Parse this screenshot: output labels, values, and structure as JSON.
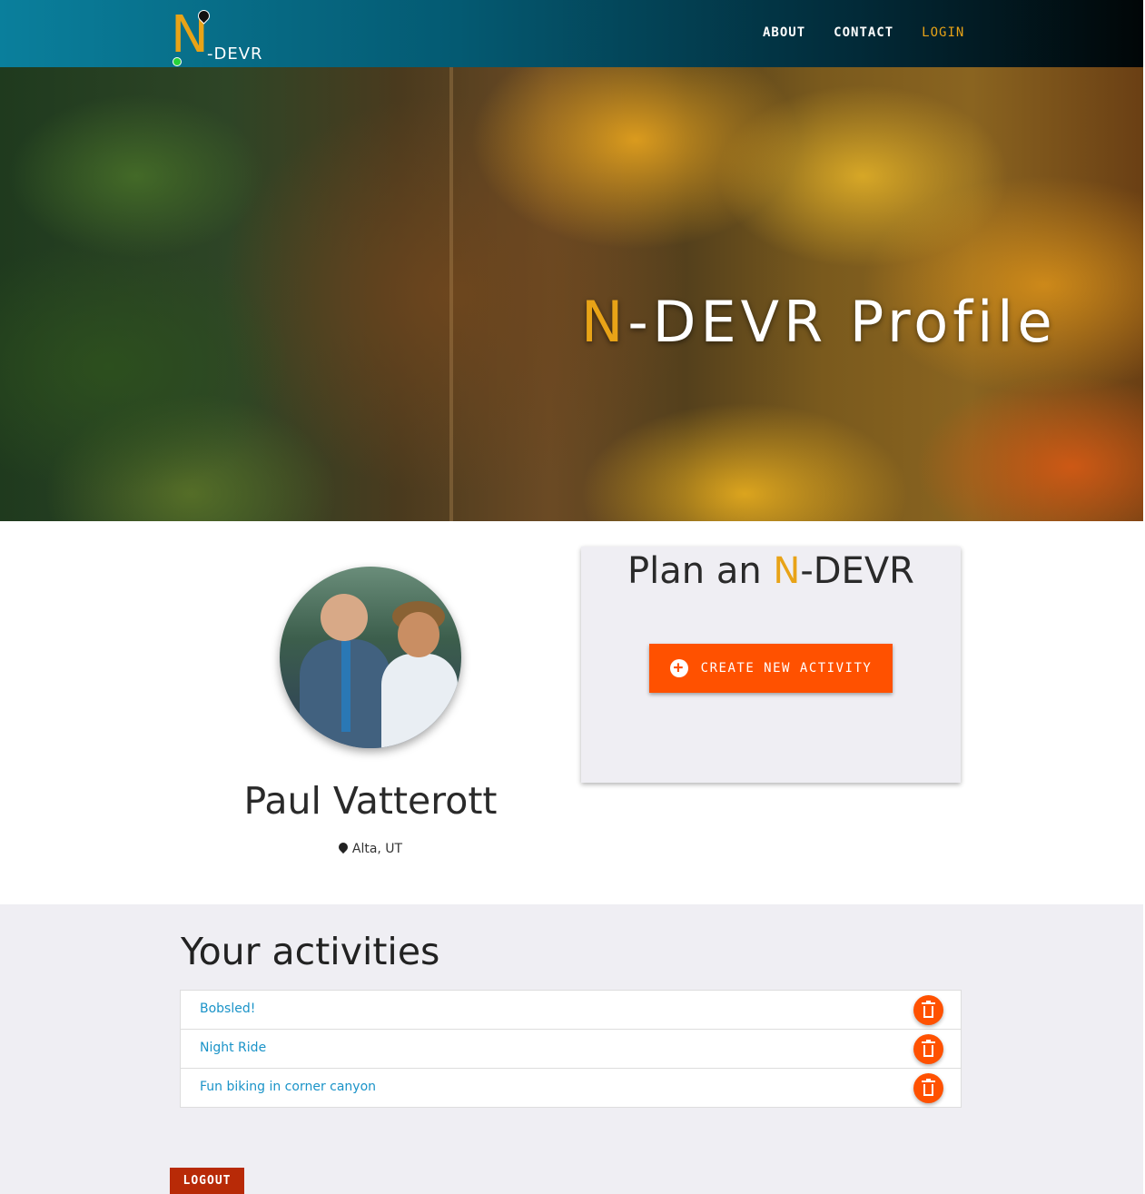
{
  "nav": {
    "logo": {
      "accent": "N",
      "rest": "-DEVR"
    },
    "links": [
      {
        "label": "ABOUT"
      },
      {
        "label": "CONTACT"
      },
      {
        "label": "LOGIN"
      }
    ]
  },
  "hero": {
    "title_accent": "N",
    "title_rest": "-DEVR Profile"
  },
  "profile": {
    "name": "Paul Vatterott",
    "location": "Alta, UT"
  },
  "plan": {
    "title_prefix": "Plan an ",
    "title_accent": "N",
    "title_rest": "-DEVR",
    "create_button": "CREATE NEW ACTIVITY"
  },
  "activities": {
    "heading": "Your activities",
    "items": [
      {
        "name": "Bobsled!"
      },
      {
        "name": "Night Ride"
      },
      {
        "name": "Fun biking in corner canyon"
      }
    ]
  },
  "logout_button": "LOGOUT",
  "colors": {
    "accent": "#e8a317",
    "action": "#ff5100",
    "link": "#1a93c8",
    "logout": "#b82a07"
  },
  "icons": [
    "map-pin-icon",
    "plus-circle-icon",
    "trash-icon"
  ]
}
